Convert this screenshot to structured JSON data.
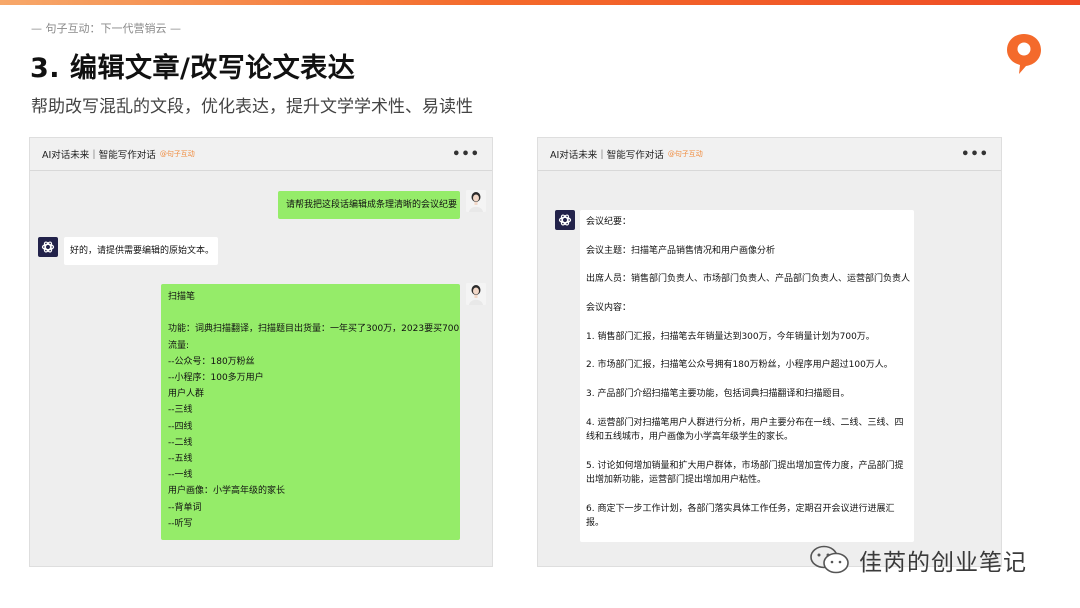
{
  "slide": {
    "tagline": "— 句子互动：下一代营销云 —",
    "title": "3. 编辑文章/改写论文表达",
    "subtitle": "帮助改写混乱的文段，优化表达，提升文学学术性、易读性",
    "watermark": "佳芮的创业笔记"
  },
  "colors": {
    "accent": "#f46a2b",
    "bubble_green": "#95ec69",
    "brand_label": "#f08a3c"
  },
  "left_panel": {
    "header_title": "AI对话未来｜智能写作对话",
    "header_brand": "@句子互动",
    "more": "•••",
    "messages": {
      "user1": "请帮我把这段话编辑成条理清晰的会议纪要",
      "bot1": "好的，请提供需要编辑的原始文本。",
      "user2_lines": [
        "扫描笔",
        "",
        "功能：词典扫描翻译，扫描题目出货量：一年买了300万，2023要买700",
        "流量:",
        "--公众号：180万粉丝",
        "--小程序：100多万用户",
        "用户人群",
        "--三线",
        "--四线",
        "--二线",
        "--五线",
        "--一线",
        "用户画像：小学高年级的家长",
        "--背单词",
        "--听写"
      ]
    }
  },
  "right_panel": {
    "header_title": "AI对话未来｜智能写作对话",
    "header_brand": "@句子互动",
    "more": "•••",
    "bot_lines": [
      "会议纪要：",
      "",
      "会议主题：扫描笔产品销售情况和用户画像分析",
      "",
      "出席人员：销售部门负责人、市场部门负责人、产品部门负责人、运营部门负责人",
      "",
      "会议内容：",
      "",
      "1. 销售部门汇报，扫描笔去年销量达到300万，今年销量计划为700万。",
      "",
      "2. 市场部门汇报，扫描笔公众号拥有180万粉丝，小程序用户超过100万人。",
      "",
      "3. 产品部门介绍扫描笔主要功能，包括词典扫描翻译和扫描题目。",
      "",
      "4. 运营部门对扫描笔用户人群进行分析，用户主要分布在一线、二线、三线、四",
      "线和五线城市，用户画像为小学高年级学生的家长。",
      "",
      "5. 讨论如何增加销量和扩大用户群体，市场部门提出增加宣传力度，产品部门提",
      "出增加新功能，运营部门提出增加用户粘性。",
      "",
      "6. 商定下一步工作计划，各部门落实具体工作任务，定期召开会议进行进展汇",
      "报。"
    ]
  },
  "icons": {
    "logo": "speech-bubble-logo-icon",
    "bot_avatar": "openai-icon",
    "user_avatar": "user-avatar-icon",
    "more": "more-dots-icon",
    "watermark": "wechat-icon"
  }
}
